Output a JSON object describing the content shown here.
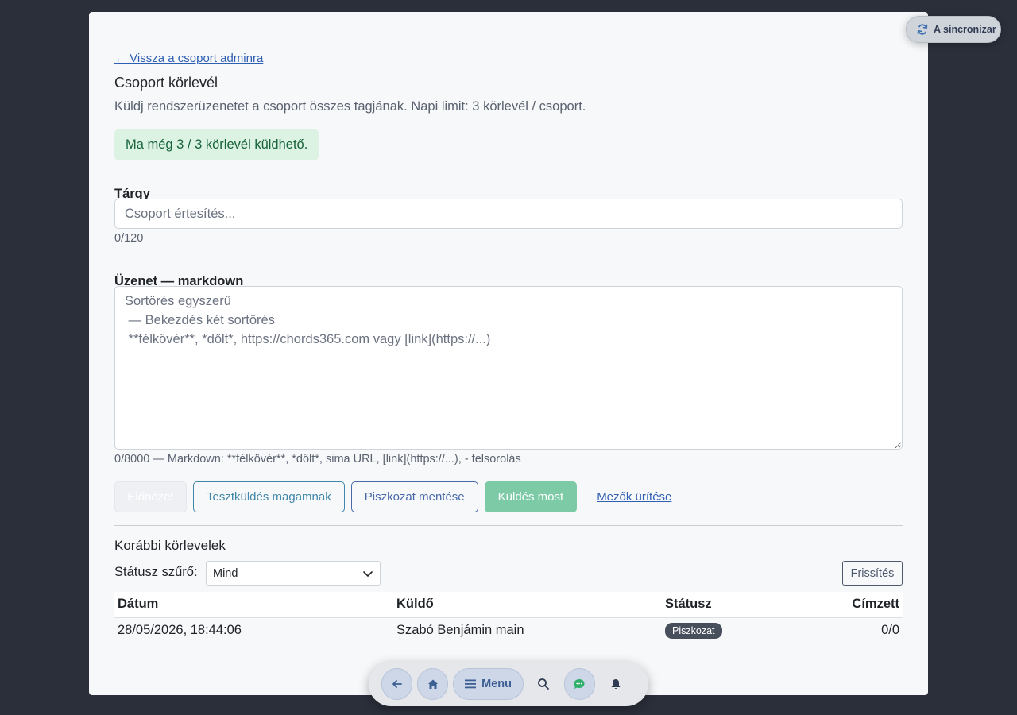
{
  "nav": {
    "back_link": "← Vissza a csoport adminra"
  },
  "header": {
    "title": "Csoport körlevél",
    "subtitle": "Küldj rendszerüzenetet a csoport összes tagjának. Napi limit: 3 körlevél / csoport."
  },
  "quota": {
    "text": "Ma még 3 / 3 körlevél küldhető."
  },
  "subject": {
    "label": "Tárgy",
    "placeholder": "Csoport értesítés...",
    "value": "",
    "counter": "0/120"
  },
  "message": {
    "label": "Üzenet — markdown",
    "placeholder": "Sortörés egyszerű\n — Bekezdés két sortörés\n **félkövér**, *dőlt*, https://chords365.com vagy [link](https://...)",
    "value": "",
    "counter": "0/8000 — Markdown: **félkövér**, *dőlt*, sima URL, [link](https://...), - felsorolás"
  },
  "actions": {
    "preview": "Előnézet",
    "test_send": "Tesztküldés magamnak",
    "save_draft": "Piszkozat mentése",
    "send_now": "Küldés most",
    "clear": "Mezők ürítése"
  },
  "history": {
    "title": "Korábbi körlevelek",
    "filter_label": "Státusz szűrő:",
    "filter_selected": "Mind",
    "refresh": "Frissítés",
    "columns": [
      "Dátum",
      "Küldő",
      "Státusz",
      "Címzett"
    ],
    "rows": [
      {
        "date": "28/05/2026, 18:44:06",
        "sender": "Szabó Benjámin main",
        "status": "Piszkozat",
        "recipients": "0/0"
      }
    ]
  },
  "sync": {
    "label": "A sincronizar"
  },
  "bottom_nav": {
    "menu_label": "Menu",
    "icons": [
      "back-arrow-icon",
      "home-icon",
      "menu-icon",
      "search-icon",
      "chat-icon",
      "bell-icon"
    ]
  },
  "colors": {
    "page_bg": "#2b2f3a",
    "card_bg": "#f7f8fa",
    "link": "#2f5fb3",
    "success_bg": "#dcf3e4",
    "success_text": "#16633a",
    "send_button": "#7ccba6",
    "badge": "#474f5c"
  }
}
